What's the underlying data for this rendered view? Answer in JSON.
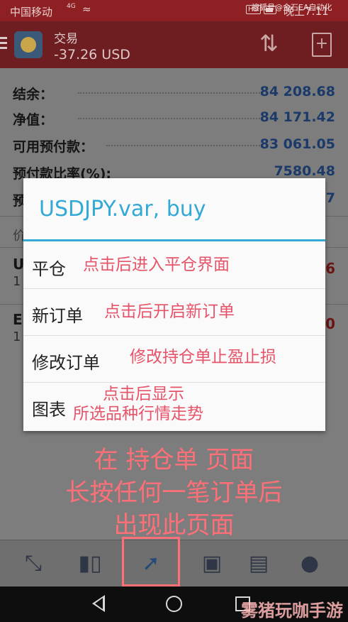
{
  "status_bar": {
    "carrier": "中国移动",
    "signal": "4G",
    "time": "晚上7:11",
    "icons": [
      "signal-icon",
      "wifi-icon",
      "hd-icon",
      "battery-icon"
    ]
  },
  "watermark_top": "搜狐号@金石EA自动化",
  "header": {
    "title": "交易",
    "balance": "-37.26 USD",
    "icons": [
      "menu-icon",
      "app-logo-icon",
      "sort-icon",
      "add-document-icon"
    ]
  },
  "account": [
    {
      "label": "结余：",
      "value": "84 208.68"
    },
    {
      "label": "净值：",
      "value": "84 171.42"
    },
    {
      "label": "可用预付款：",
      "value": "83 061.05"
    },
    {
      "label": "预付款比率(%):",
      "value": "7580.48"
    },
    {
      "label": "预",
      "value": "7"
    }
  ],
  "position_header": "价",
  "positions": [
    {
      "symbol": "U",
      "sub": "1",
      "profit": "6"
    },
    {
      "symbol": "E",
      "sub": "1",
      "profit": "0"
    }
  ],
  "dialog": {
    "title": "USDJPY.var, buy",
    "items": [
      {
        "label": "平仓",
        "annotation": [
          "点击后进入平仓界面"
        ]
      },
      {
        "label": "新订单",
        "annotation": [
          "点击后开启新订单"
        ]
      },
      {
        "label": "修改订单",
        "annotation": [
          "修改持仓单止盈止损"
        ]
      },
      {
        "label": "图表",
        "annotation": [
          "点击后显示",
          "所选品种行情走势"
        ]
      }
    ]
  },
  "annotation_lines": [
    "在 持仓单 页面",
    "长按任何一笔订单后",
    "出现此页面"
  ],
  "tabs": [
    {
      "name": "quotes",
      "icon": "quotes-arrows-icon",
      "active": false
    },
    {
      "name": "chart",
      "icon": "candlestick-icon",
      "active": false
    },
    {
      "name": "trade",
      "icon": "trend-line-icon",
      "active": true
    },
    {
      "name": "history",
      "icon": "inbox-icon",
      "active": false
    },
    {
      "name": "news",
      "icon": "newspaper-icon",
      "active": false
    },
    {
      "name": "messages",
      "icon": "chat-bubble-icon",
      "active": false
    }
  ],
  "watermark_bottom": "雾猪玩咖手游网",
  "colors": {
    "title_blue": "#33a9d6",
    "annotation_red": "#e6546a",
    "header_bg": "#6e1d20"
  }
}
